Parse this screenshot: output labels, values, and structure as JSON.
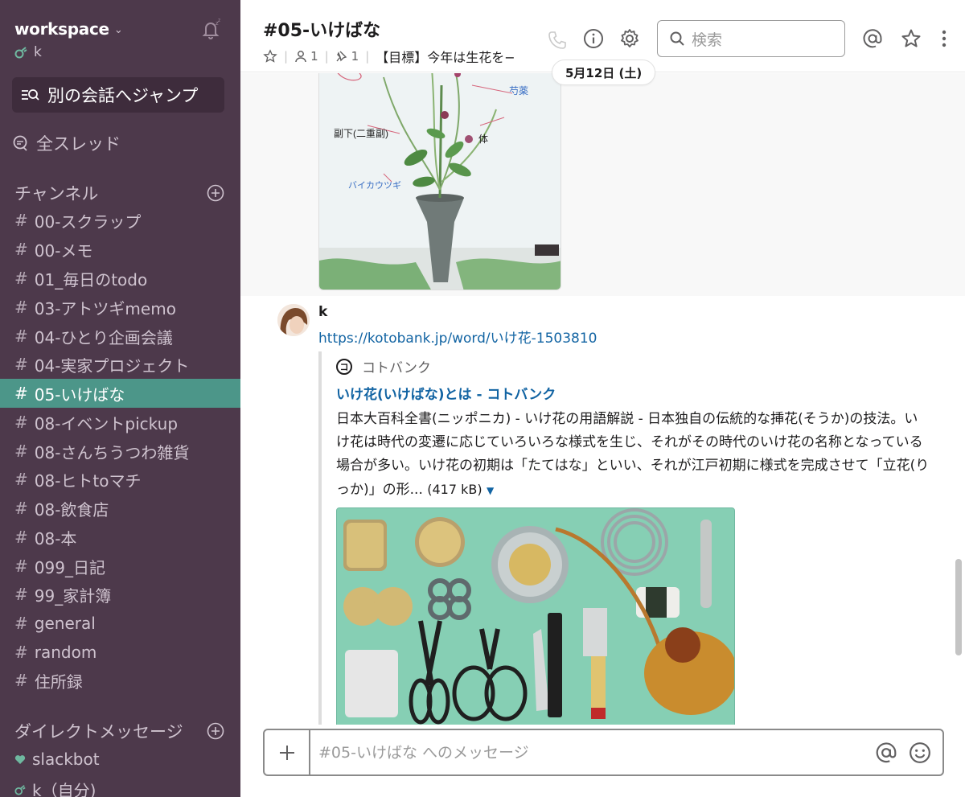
{
  "sidebar": {
    "workspace": "workspace",
    "user": "k",
    "jump_label": "別の会話へジャンプ",
    "threads_label": "全スレッド",
    "channels_header": "チャンネル",
    "channels": [
      {
        "name": "00-スクラップ"
      },
      {
        "name": "00-メモ"
      },
      {
        "name": "01_毎日のtodo"
      },
      {
        "name": "03-アトツギmemo"
      },
      {
        "name": "04-ひとり企画会議"
      },
      {
        "name": "04-実家プロジェクト"
      },
      {
        "name": "05-いけばな",
        "active": true
      },
      {
        "name": "08-イベントpickup"
      },
      {
        "name": "08-さんちうつわ雑貨"
      },
      {
        "name": "08-ヒトtoマチ"
      },
      {
        "name": "08-飲食店"
      },
      {
        "name": "08-本"
      },
      {
        "name": "099_日記"
      },
      {
        "name": "99_家計簿"
      },
      {
        "name": "general"
      },
      {
        "name": "random"
      },
      {
        "name": "住所録"
      }
    ],
    "dm_header": "ダイレクトメッセージ",
    "dms": [
      {
        "name": "slackbot"
      },
      {
        "name": "k（自分)"
      }
    ]
  },
  "header": {
    "channel_title": "#05-いけばな",
    "members": "1",
    "pins": "1",
    "topic": "【目標】今年は生花を−",
    "search_placeholder": "検索",
    "date_divider": "5月12日 (土)"
  },
  "messages": {
    "image_labels": {
      "shakuyaku": "芍薬",
      "soeshita": "副下(二重副)",
      "tai": "体",
      "baikautsugi": "バイカウツギ"
    },
    "author": "k",
    "link": "https://kotobank.jp/word/いけ花-1503810",
    "unfurl": {
      "service_icon": "コ",
      "service": "コトバンク",
      "title": "いけ花(いけばな)とは - コトバンク",
      "description": "日本大百科全書(ニッポニカ) - いけ花の用語解説 - 日本独自の伝統的な挿花(そうか)の技法。いけ花は時代の変遷に応じていろいろな様式を生じ、それがその時代のいけ花の名称となっている場合が多い。いけ花の初期は「たてはな」といい、それが江戸初期に様式を完成させて「立花(りっか)」の形...",
      "size": "(417 kB)"
    }
  },
  "composer": {
    "placeholder": "#05-いけばな へのメッセージ"
  },
  "colors": {
    "sidebar_bg": "#4d394b",
    "active_channel": "#4c9689",
    "link": "#1264a3"
  }
}
